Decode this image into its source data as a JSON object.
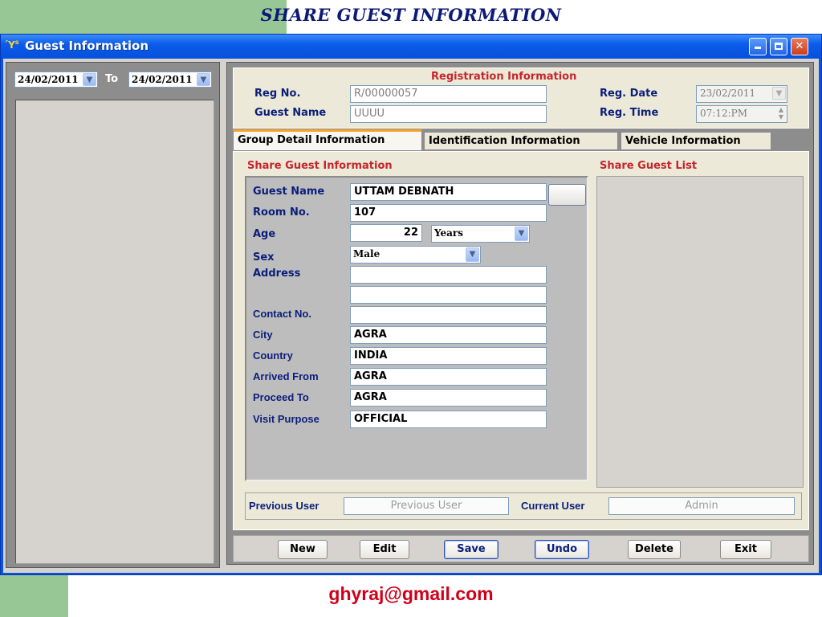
{
  "slide": {
    "title": "SHARE GUEST INFORMATION",
    "footer_email": "ghyraj@gmail.com"
  },
  "window": {
    "title": "Guest Information",
    "icon": "app-icon",
    "controls": {
      "minimize": "_",
      "maximize": "□",
      "close": "✕"
    }
  },
  "filter": {
    "from_date": "24/02/2011",
    "to_label": "To",
    "to_date": "24/02/2011"
  },
  "registration": {
    "heading": "Registration  Information",
    "reg_no_label": "Reg No.",
    "reg_no_value": "R/00000057",
    "guest_name_label": "Guest Name",
    "guest_name_value": "UUUU",
    "reg_date_label": "Reg. Date",
    "reg_date_value": "23/02/2011",
    "reg_time_label": "Reg. Time",
    "reg_time_value": "07:12:PM"
  },
  "tabs": [
    {
      "label": "Group Detail Information",
      "active": true
    },
    {
      "label": "Identification Information",
      "active": false
    },
    {
      "label": "Vehicle Information",
      "active": false
    }
  ],
  "share_form": {
    "heading": "Share Guest Information",
    "list_heading": "Share Guest List",
    "fields": {
      "guest_name": {
        "label": "Guest Name",
        "value": "UTTAM DEBNATH"
      },
      "room_no": {
        "label": "Room No.",
        "value": "107"
      },
      "age": {
        "label": "Age",
        "value": "22",
        "unit": "Years"
      },
      "sex": {
        "label": "Sex",
        "value": "Male"
      },
      "address": {
        "label": "Address",
        "value1": "",
        "value2": ""
      },
      "contact_no": {
        "label": "Contact No.",
        "value": ""
      },
      "city": {
        "label": "City",
        "value": "AGRA"
      },
      "country": {
        "label": "Country",
        "value": "INDIA"
      },
      "arrived_from": {
        "label": "Arrived From",
        "value": "AGRA"
      },
      "proceed_to": {
        "label": "Proceed To",
        "value": "AGRA"
      },
      "visit_purpose": {
        "label": "Visit Purpose",
        "value": "OFFICIAL"
      }
    }
  },
  "users": {
    "previous_label": "Previous User",
    "previous_value": "Previous User",
    "current_label": "Current User",
    "current_value": "Admin"
  },
  "buttons": {
    "new": "New",
    "edit": "Edit",
    "save": "Save",
    "undo": "Undo",
    "delete": "Delete",
    "exit": "Exit"
  }
}
